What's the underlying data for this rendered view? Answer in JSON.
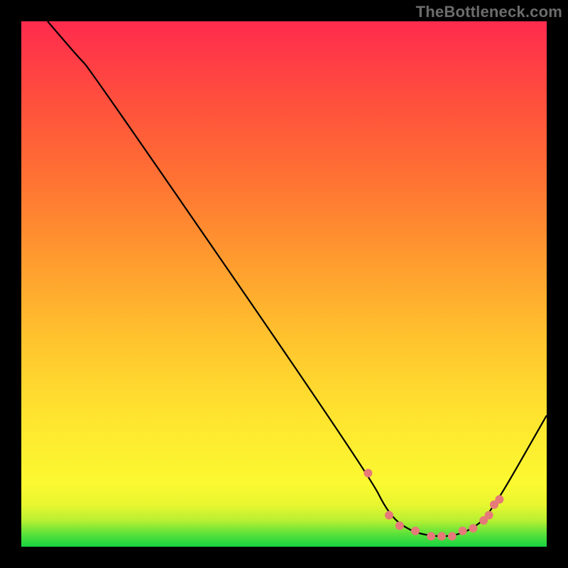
{
  "watermark": "TheBottleneck.com",
  "chart_data": {
    "type": "line",
    "title": "",
    "xlabel": "",
    "ylabel": "",
    "xlim": [
      0,
      100
    ],
    "ylim": [
      0,
      100
    ],
    "series": [
      {
        "name": "bottleneck-curve",
        "x": [
          5,
          11,
          13,
          66,
          70,
          74,
          78,
          82,
          85,
          88,
          90,
          92,
          100
        ],
        "y": [
          100,
          93,
          91,
          14,
          6,
          3,
          2,
          2,
          3,
          5,
          8,
          11,
          25
        ]
      }
    ],
    "markers": {
      "name": "highlighted-points",
      "x": [
        66,
        70,
        72,
        75,
        78,
        80,
        82,
        84,
        86,
        88,
        89,
        90,
        91
      ],
      "y": [
        14,
        6,
        4,
        3,
        2,
        2,
        2,
        3,
        3.5,
        5,
        6,
        8,
        9
      ]
    },
    "background_gradient": {
      "direction": "vertical",
      "stops": [
        {
          "pos": 0.0,
          "color": "#17d440"
        },
        {
          "pos": 0.05,
          "color": "#b8f032"
        },
        {
          "pos": 0.12,
          "color": "#fbf930"
        },
        {
          "pos": 0.4,
          "color": "#ffc22e"
        },
        {
          "pos": 0.7,
          "color": "#ff7233"
        },
        {
          "pos": 1.0,
          "color": "#ff2b4e"
        }
      ]
    }
  }
}
